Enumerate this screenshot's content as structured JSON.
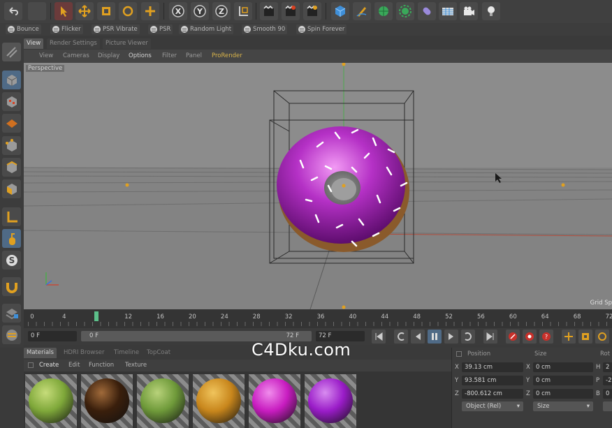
{
  "colors": {
    "accent_orange": "#e0a020",
    "pro_render": "#d9b44a",
    "donut_icing": "#b531c6",
    "donut_dough": "#8a5a2b",
    "viewport_bg": "#878787"
  },
  "toolbar": {
    "icons": [
      "undo-icon",
      "select-icon",
      "move-icon",
      "scale-icon",
      "rotate-icon",
      "add-icon",
      "x-axis-icon",
      "y-axis-icon",
      "z-axis-icon",
      "coordinate-system-icon",
      "render-view-icon",
      "render-picture-icon",
      "render-settings-icon",
      "cube-icon",
      "pen-icon",
      "subdivision-icon",
      "mograph-icon",
      "deformer-icon",
      "scene-icon",
      "camera-icon",
      "light-icon"
    ],
    "axis_labels": [
      "X",
      "Y",
      "Z"
    ]
  },
  "plugins": [
    "Bounce",
    "Flicker",
    "PSR Vibrate",
    "PSR",
    "Random Light",
    "Smooth 90",
    "Spin Forever"
  ],
  "view_tabs": [
    "View",
    "Render Settings",
    "Picture Viewer"
  ],
  "viewport_menu": [
    "View",
    "Cameras",
    "Display",
    "Options",
    "Filter",
    "Panel",
    "ProRender"
  ],
  "viewport": {
    "label": "Perspective",
    "grid_spacing": "Grid Sp"
  },
  "timeline": {
    "ticks": [
      "0",
      "4",
      "8",
      "12",
      "16",
      "20",
      "24",
      "28",
      "32",
      "36",
      "40",
      "44",
      "48",
      "52",
      "56",
      "60",
      "64",
      "68",
      "72"
    ],
    "current_frame": 8
  },
  "transport": {
    "start_field": "0 F",
    "range_start": "0 F",
    "range_end": "72 F",
    "end_field": "72 F"
  },
  "material_tabs": [
    "Materials",
    "HDRI Browser",
    "Timeline",
    "TopCoat"
  ],
  "material_menu": [
    "Create",
    "Edit",
    "Function",
    "Texture"
  ],
  "materials": [
    {
      "color": "#7fa83a",
      "highlight": "#c6dc7a"
    },
    {
      "color": "#3a1f0c",
      "highlight": "#a06a3a"
    },
    {
      "color": "#6f9a3a",
      "highlight": "#b8d27a"
    },
    {
      "color": "#c8861c",
      "highlight": "#f0c45c"
    },
    {
      "color": "#c81cc0",
      "highlight": "#f08cec"
    },
    {
      "color": "#9a1cc8",
      "highlight": "#d88cf0"
    }
  ],
  "coords": {
    "headers": [
      "Position",
      "Size",
      "Rot"
    ],
    "rows": [
      {
        "axis": "X",
        "position": "39.13 cm",
        "size_axis": "X",
        "size": "0 cm",
        "rot_axis": "H",
        "rot": "2"
      },
      {
        "axis": "Y",
        "position": "93.581 cm",
        "size_axis": "Y",
        "size": "0 cm",
        "rot_axis": "P",
        "rot": "-2"
      },
      {
        "axis": "Z",
        "position": "-800.612 cm",
        "size_axis": "Z",
        "size": "0 cm",
        "rot_axis": "B",
        "rot": "0"
      }
    ],
    "mode_select": "Object (Rel)",
    "size_select": "Size"
  },
  "watermark": "C4Dku.com"
}
